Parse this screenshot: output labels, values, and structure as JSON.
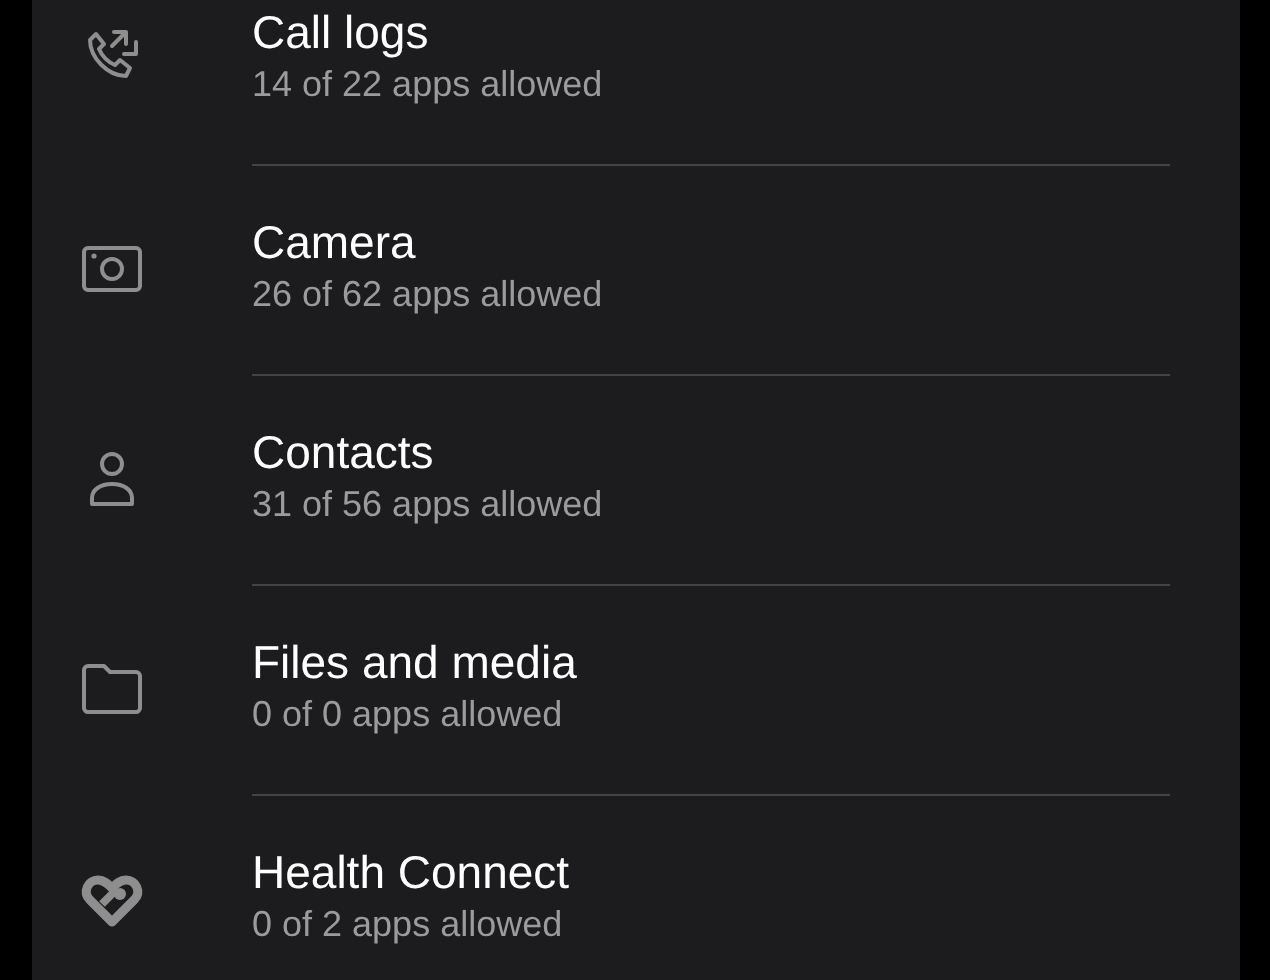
{
  "permissions": [
    {
      "title": "Call logs",
      "subtitle": "14 of 22 apps allowed"
    },
    {
      "title": "Camera",
      "subtitle": "26 of 62 apps allowed"
    },
    {
      "title": "Contacts",
      "subtitle": "31 of 56 apps allowed"
    },
    {
      "title": "Files and media",
      "subtitle": "0 of 0 apps allowed"
    },
    {
      "title": "Health Connect",
      "subtitle": "0 of 2 apps allowed"
    }
  ]
}
